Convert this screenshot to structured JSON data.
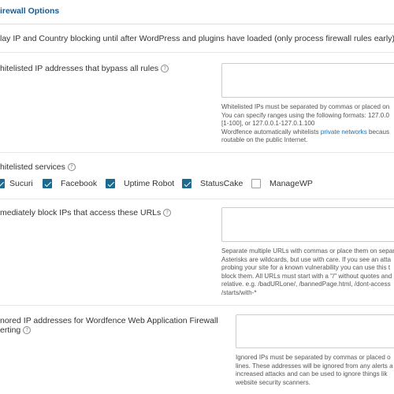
{
  "section": {
    "title": "irewall Options"
  },
  "delay_blocking": {
    "label": "lay IP and Country blocking until after WordPress and plugins have loaded (only process firewall rules early)"
  },
  "whitelisted_ips": {
    "label": "hitelisted IP addresses that bypass all rules",
    "value": "",
    "help_lines": [
      "Whitelisted IPs must be separated by commas or placed on",
      "You can specify ranges using the following formats: 127.0.0",
      "[1-100], or 127.0.0.1-127.0.1.100"
    ],
    "help_line4_before": "Wordfence automatically whitelists ",
    "help_link": "private networks",
    "help_line4_after": " becaus",
    "help_line5": "routable on the public Internet."
  },
  "whitelisted_services": {
    "label": "hitelisted services",
    "items": [
      {
        "label": "Sucuri",
        "checked": true
      },
      {
        "label": "Facebook",
        "checked": true
      },
      {
        "label": "Uptime Robot",
        "checked": true
      },
      {
        "label": "StatusCake",
        "checked": true
      },
      {
        "label": "ManageWP",
        "checked": false
      }
    ]
  },
  "block_urls": {
    "label": "mediately block IPs that access these URLs",
    "value": "",
    "help_lines": [
      "Separate multiple URLs with commas or place them on separ",
      "Asterisks are wildcards, but use with care. If you see an atta",
      "probing your site for a known vulnerability you can use this t",
      "block them. All URLs must start with a \"/\" without quotes and",
      "relative. e.g. /badURLone/, /bannedPage.html, /dont-access",
      "/starts/with-*"
    ]
  },
  "ignored_ips": {
    "label_line1": "nored IP addresses for Wordfence Web Application Firewall",
    "label_line2": "erting",
    "value": "",
    "help_lines": [
      "Ignored IPs must be separated by commas or placed o",
      "lines. These addresses will be ignored from any alerts a",
      "increased attacks and can be used to ignore things lik",
      "website security scanners."
    ]
  },
  "colors": {
    "title": "#1b5a91",
    "checkbox_checked": "#1b6a8f",
    "link": "#2271b1"
  }
}
